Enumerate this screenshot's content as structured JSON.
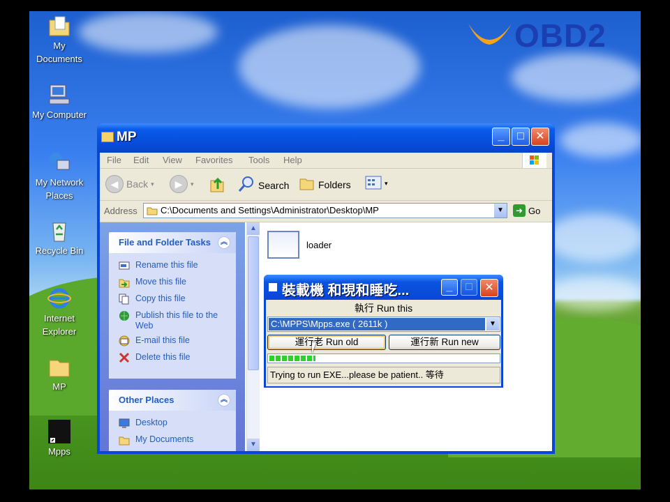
{
  "logo": {
    "text": "OBD2"
  },
  "desktop_icons": [
    {
      "label": "My Documents"
    },
    {
      "label": "My Computer"
    },
    {
      "label": "My Network Places"
    },
    {
      "label": "Recycle Bin"
    },
    {
      "label": "Internet Explorer"
    },
    {
      "label": "MP"
    },
    {
      "label": "Mpps"
    }
  ],
  "explorer": {
    "title": "MP",
    "menu": [
      "File",
      "Edit",
      "View",
      "Favorites",
      "Tools",
      "Help"
    ],
    "toolbar": {
      "back": "Back",
      "search": "Search",
      "folders": "Folders"
    },
    "address": {
      "label": "Address",
      "value": "C:\\Documents and Settings\\Administrator\\Desktop\\MP",
      "go": "Go"
    },
    "file_tasks": {
      "heading": "File and Folder Tasks",
      "items": [
        "Rename this file",
        "Move this file",
        "Copy this file",
        "Publish this file to the Web",
        "E-mail this file",
        "Delete this file"
      ]
    },
    "other_places": {
      "heading": "Other Places",
      "items": [
        "Desktop",
        "My Documents"
      ]
    },
    "files": [
      {
        "name": "loader"
      }
    ]
  },
  "dialog": {
    "title": "裝載機 和現和睡吃...",
    "label": "執行 Run this",
    "combo_value": "C:\\MPPS\\Mpps.exe ( 2611k )",
    "btn_old": "運行老 Run old",
    "btn_new": "運行新 Run new",
    "progress": 0.2,
    "status": "Trying to run EXE...please be patient.. 等待"
  },
  "colors": {
    "xp_blue": "#0846d8",
    "task_link": "#215dc6",
    "progress": "#2bd22b"
  }
}
